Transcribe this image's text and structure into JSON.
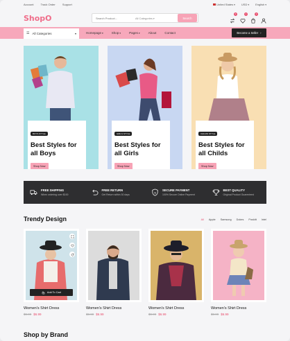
{
  "topbar": {
    "links": [
      "Account",
      "Track Order",
      "Support"
    ],
    "country": "United States",
    "currency": "USD",
    "language": "English"
  },
  "header": {
    "logo": "ShopO",
    "search_placeholder": "Search Product...",
    "category": "All Categories",
    "search_button": "Search",
    "badges": {
      "compare": "2",
      "wishlist": "1",
      "cart": "1"
    }
  },
  "nav": {
    "all_categories": "All Categories",
    "menu": [
      "Homepage",
      "Shop",
      "Pages",
      "About",
      "Contact"
    ],
    "seller_button": "Become a Seller"
  },
  "banners": [
    {
      "tag": "BOYS STYLE",
      "title": "Best Styles for all Boys",
      "button": "Shop Now",
      "bg": "#a9e1e6"
    },
    {
      "tag": "GIRLS STYLE",
      "title": "Best Styles for all Girls",
      "button": "Shop Now",
      "bg": "#c8d7f2"
    },
    {
      "tag": "CHILDS STYLE",
      "title": "Best Styles for all Childs",
      "button": "Shop Now",
      "bg": "#f9dfb3"
    }
  ],
  "features": [
    {
      "icon": "truck-icon",
      "title": "FREE SHIPPING",
      "sub": "When ordering over $100"
    },
    {
      "icon": "return-icon",
      "title": "FREE RETURN",
      "sub": "Get Return within 30 days"
    },
    {
      "icon": "shield-icon",
      "title": "SECURE PAYMENT",
      "sub": "100% Secure Online Payment"
    },
    {
      "icon": "trophy-icon",
      "title": "BEST QUALITY",
      "sub": "Original Product Guarenteed"
    }
  ],
  "trendy": {
    "title": "Trendy Design",
    "filters": [
      "All",
      "Apple",
      "Samsung",
      "Dokes",
      "Poskitt",
      "Intel"
    ],
    "active_filter": "All",
    "add_to_cart": "Add To Cart",
    "products": [
      {
        "name": "Women's Shirt Dress",
        "old_price": "$9.99",
        "price": "$6.99",
        "bg": "#cfe3ea"
      },
      {
        "name": "Women's Shirt Dress",
        "old_price": "$9.99",
        "price": "$6.99",
        "bg": "#dcdcdc"
      },
      {
        "name": "Women's Shirt Dress",
        "old_price": "$9.99",
        "price": "$6.99",
        "bg": "#d9b46a"
      },
      {
        "name": "Women's Shirt Dress",
        "old_price": "$9.99",
        "price": "$6.99",
        "bg": "#f5b3c6"
      }
    ]
  },
  "brand": {
    "title": "Shop by Brand"
  }
}
